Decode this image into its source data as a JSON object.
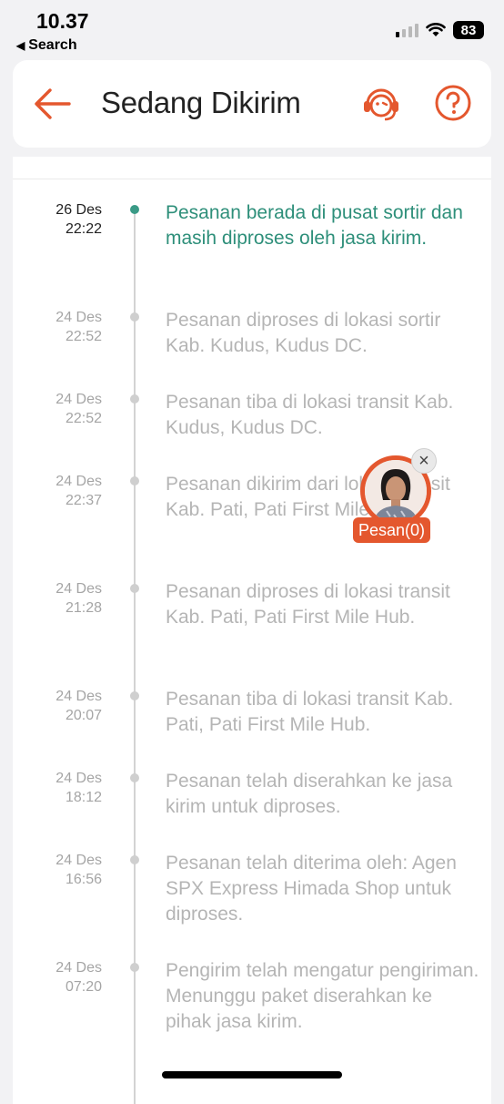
{
  "status_bar": {
    "time": "10.37",
    "back_label": "Search",
    "battery": "83"
  },
  "header": {
    "title": "Sedang Dikirim"
  },
  "colors": {
    "accent": "#e4572e",
    "active_green": "#2e8f7a",
    "inactive_text": "#b5b5b5"
  },
  "events": [
    {
      "date": "26 Des",
      "time": "22:22",
      "text": "Pesanan berada di pusat sortir dan masih diproses oleh jasa kirim."
    },
    {
      "date": "24 Des",
      "time": "22:52",
      "text": "Pesanan diproses di lokasi sortir Kab. Kudus, Kudus DC."
    },
    {
      "date": "24 Des",
      "time": "22:52",
      "text": "Pesanan tiba di lokasi transit Kab. Kudus, Kudus DC."
    },
    {
      "date": "24 Des",
      "time": "22:37",
      "text": "Pesanan dikirim dari lokasi transit Kab. Pati, Pati First Mile Hub."
    },
    {
      "date": "24 Des",
      "time": "21:28",
      "text": "Pesanan diproses di lokasi transit Kab. Pati, Pati First Mile Hub."
    },
    {
      "date": "24 Des",
      "time": "20:07",
      "text": "Pesanan tiba di lokasi transit Kab. Pati, Pati First Mile Hub."
    },
    {
      "date": "24 Des",
      "time": "18:12",
      "text": "Pesanan telah diserahkan ke jasa kirim untuk diproses."
    },
    {
      "date": "24 Des",
      "time": "16:56",
      "text": "Pesanan telah diterima oleh: Agen SPX Express Himada Shop untuk diproses."
    },
    {
      "date": "24 Des",
      "time": "07:20",
      "text": "Pengirim telah mengatur pengiriman. Menunggu paket diserahkan ke pihak jasa kirim."
    }
  ],
  "chat": {
    "label": "Pesan(0)"
  }
}
